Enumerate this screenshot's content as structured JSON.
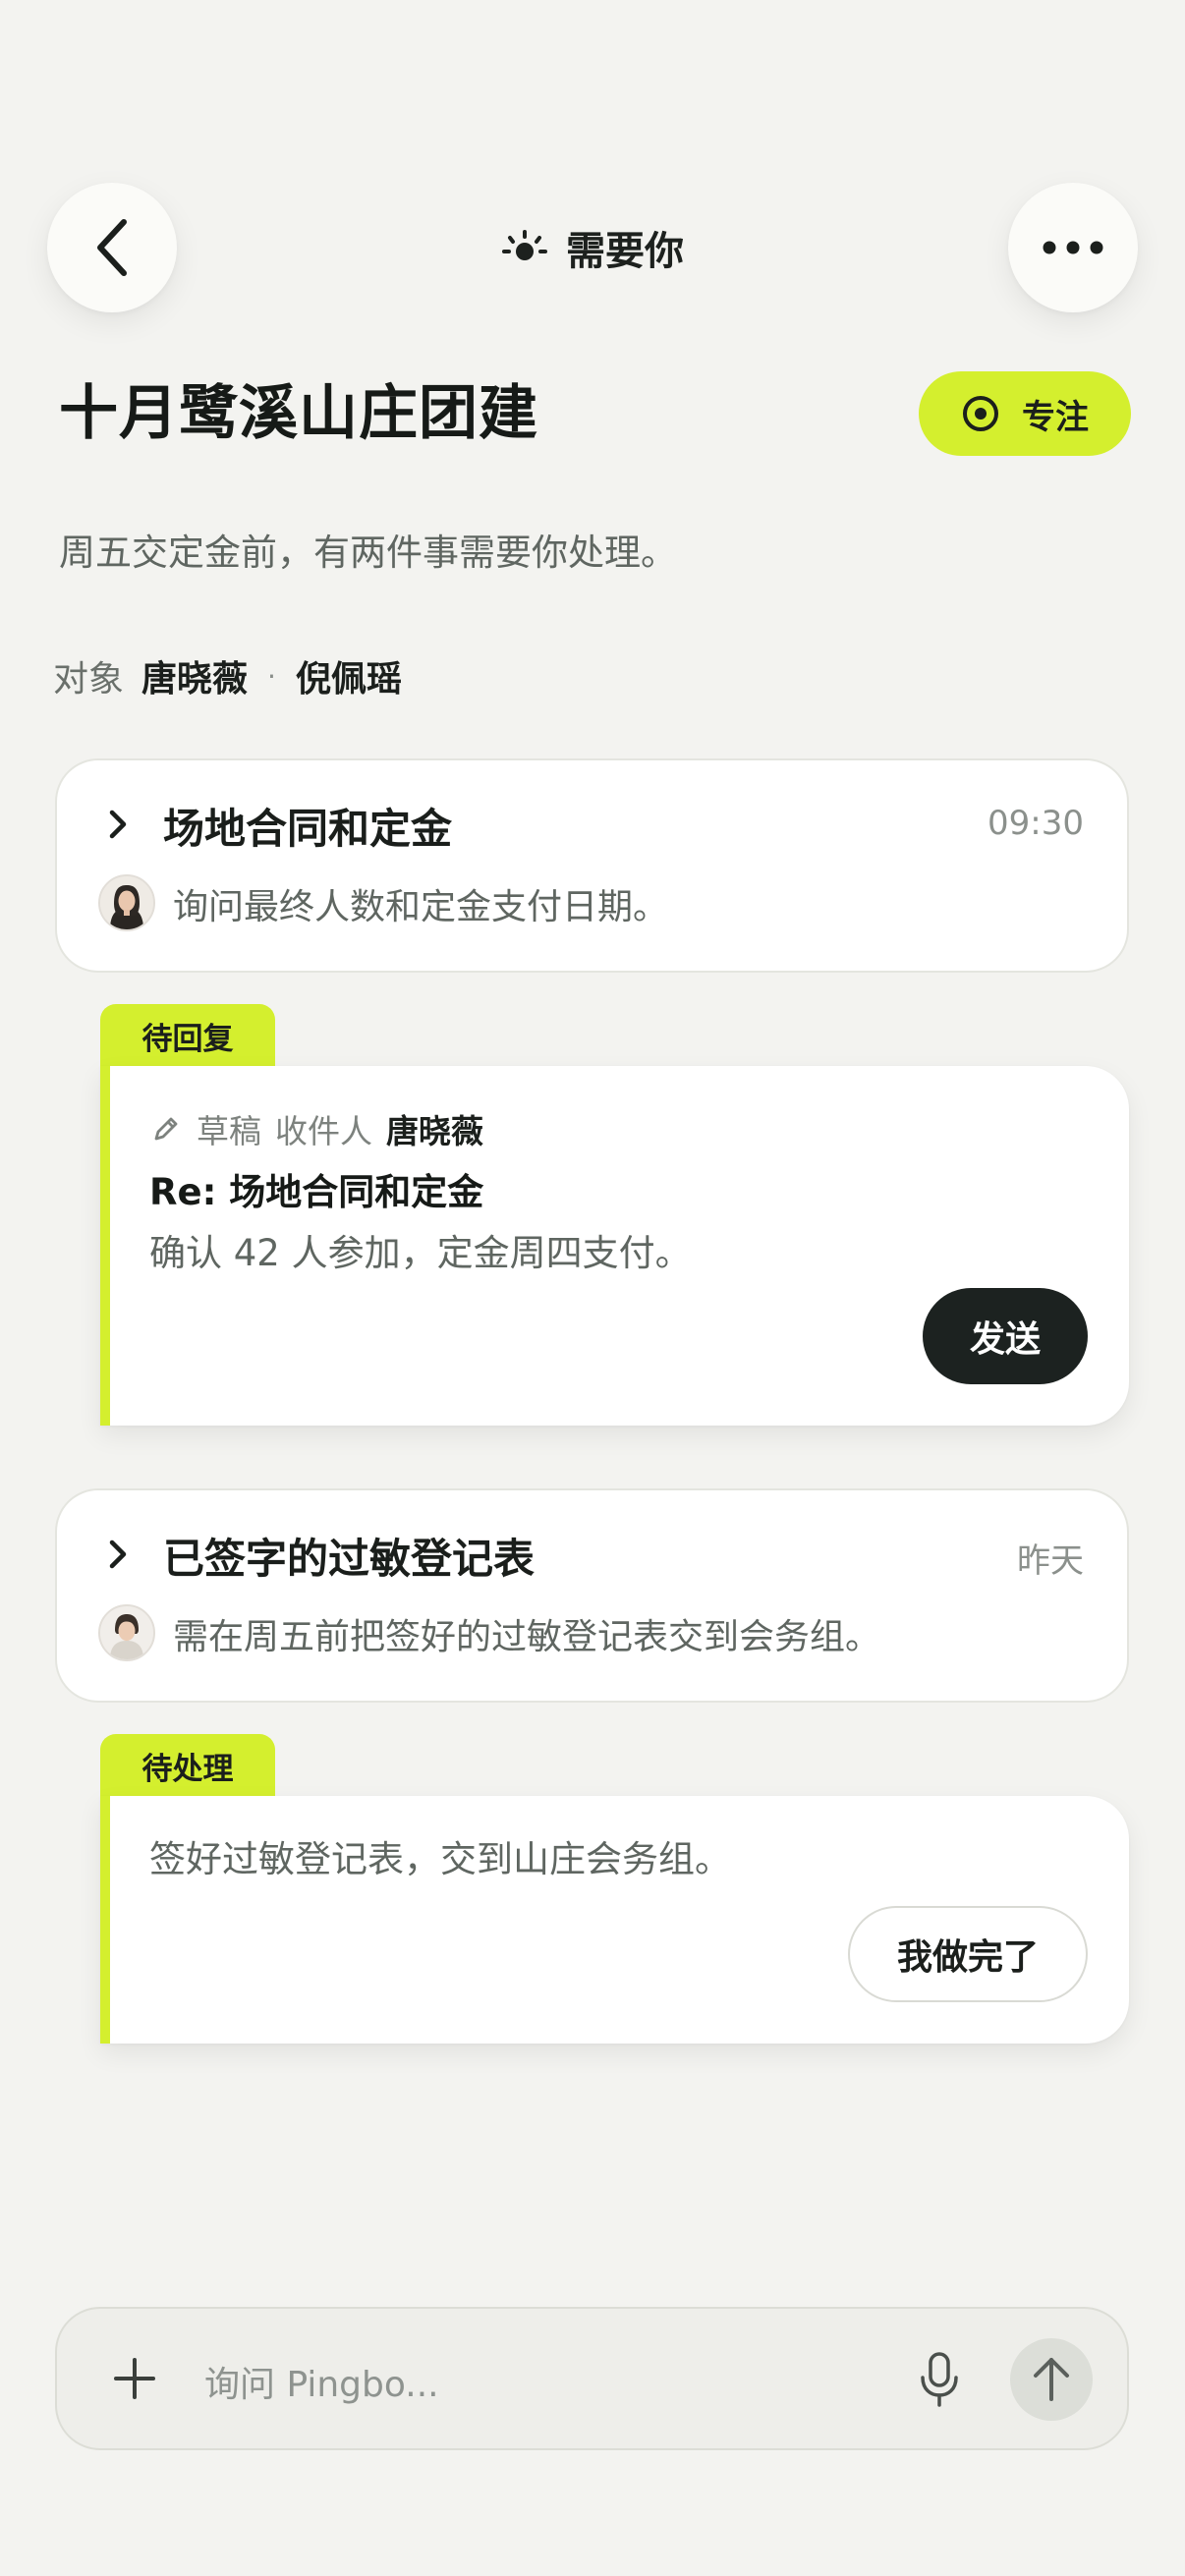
{
  "header": {
    "title": "需要你",
    "back_icon": "chevron-left-icon",
    "more_icon": "more-horizontal-icon",
    "title_icon": "sun-icon"
  },
  "page": {
    "title": "十月鹭溪山庄团建",
    "focus_label": "专注",
    "subtitle": "周五交定金前，有两件事需要你处理。",
    "targets_label": "对象",
    "targets": [
      "唐晓薇",
      "倪佩瑶"
    ],
    "target_separator": "·"
  },
  "items": [
    {
      "title": "场地合同和定金",
      "time": "09:30",
      "snippet": "询问最终人数和定金支付日期。",
      "tag": "待回复",
      "draft": {
        "label": "草稿",
        "recipient_label": "收件人",
        "recipient": "唐晓薇",
        "subject": "Re: 场地合同和定金",
        "body": "确认 42 人参加，定金周四支付。",
        "send_label": "发送"
      }
    },
    {
      "title": "已签字的过敏登记表",
      "time": "昨天",
      "snippet": "需在周五前把签好的过敏登记表交到会务组。",
      "tag": "待处理",
      "todo": {
        "body": "签好过敏登记表，交到山庄会务组。",
        "done_label": "我做完了"
      }
    }
  ],
  "composer": {
    "placeholder": "询问 Pingbo..."
  },
  "colors": {
    "accent": "#d4ef2e",
    "background": "#f3f3f0",
    "dark_button": "#1c2220"
  }
}
